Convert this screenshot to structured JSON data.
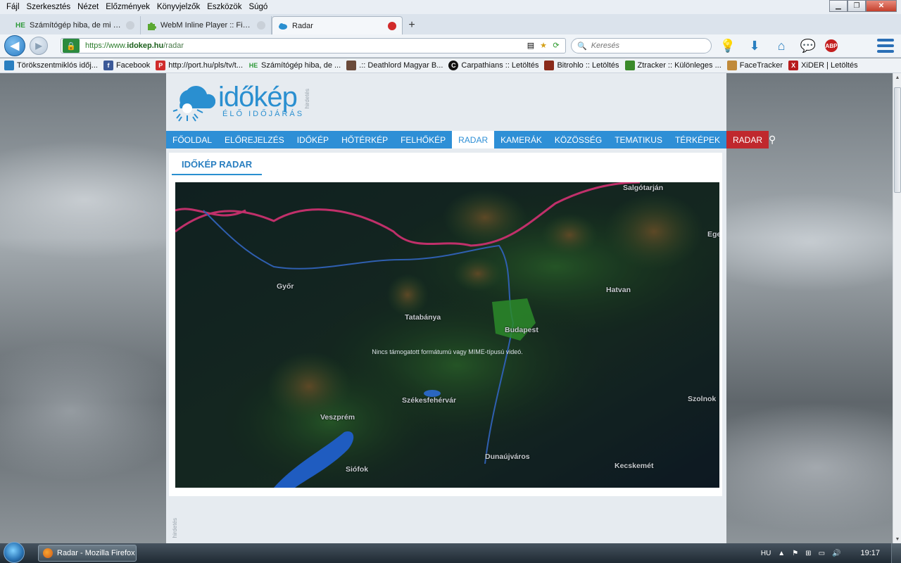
{
  "menubar": {
    "items": [
      "Fájl",
      "Szerkesztés",
      "Nézet",
      "Előzmények",
      "Könyvjelzők",
      "Eszközök",
      "Súgó"
    ]
  },
  "tabs": [
    {
      "label": "Számítógép hiba, de mi a p...",
      "icon": "HE"
    },
    {
      "label": "WebM Inline Player :: Firef...",
      "icon": "addon-icon"
    },
    {
      "label": "Radar",
      "icon": "idokep-icon"
    }
  ],
  "navbar": {
    "url_proto": "https://www.",
    "url_host": "idokep.hu",
    "url_path": "/radar",
    "search_placeholder": "Keresés"
  },
  "bookmarks": [
    {
      "label": "Törökszentmiklós időj...",
      "icon": "",
      "color": "#2a7fc0"
    },
    {
      "label": "Facebook",
      "icon": "f",
      "color": "#3b5998"
    },
    {
      "label": "http://port.hu/pls/tv/t...",
      "icon": "P",
      "color": "#d02c2c"
    },
    {
      "label": "Számítógép hiba, de ...",
      "icon": "HE",
      "color": "#2f9a3a"
    },
    {
      "label": ".:: Deathlord Magyar B...",
      "icon": "",
      "color": "#6a4a3a"
    },
    {
      "label": "Carpathians :: Letöltés",
      "icon": "C",
      "color": "#111111"
    },
    {
      "label": "Bitrohlo :: Letöltés",
      "icon": "",
      "color": "#8a2a1a"
    },
    {
      "label": "Ztracker :: Különleges ...",
      "icon": "",
      "color": "#3a8a2a"
    },
    {
      "label": "FaceTracker",
      "icon": "",
      "color": "#c08a3a"
    },
    {
      "label": "XiDER | Letöltés",
      "icon": "X",
      "color": "#b81c1c"
    }
  ],
  "site": {
    "logo_main": "időkép",
    "logo_sub": "ÉLŐ IDŐJÁRÁS",
    "ad_label": "hirdetés",
    "nav": [
      "FŐOLDAL",
      "ELŐREJELZÉS",
      "IDŐKÉP",
      "HŐTÉRKÉP",
      "FELHŐKÉP",
      "RADAR",
      "KAMERÁK",
      "KÖZÖSSÉG",
      "TEMATIKUS",
      "TÉRKÉPEK"
    ],
    "nav_red": "RADAR",
    "section_title": "IDŐKÉP RADAR",
    "video_message": "Nincs támogatott formátumú vagy MIME-típusú videó.",
    "cities": [
      "Salgótarján",
      "Eger",
      "Győr",
      "Hatvan",
      "Tatabánya",
      "Budapest",
      "Székesfehérvár",
      "Szolnok",
      "Veszprém",
      "Siófok",
      "Dunaújváros",
      "Kecskemét"
    ]
  },
  "taskbar": {
    "window_label": "Radar - Mozilla Firefox",
    "lang": "HU",
    "time": "19:17"
  }
}
